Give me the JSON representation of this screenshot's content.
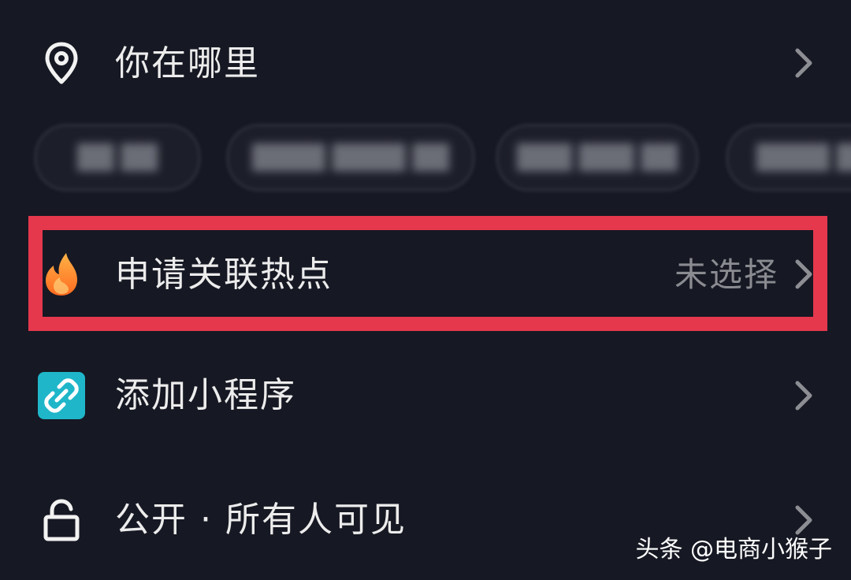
{
  "rows": {
    "location": {
      "label": "你在哪里",
      "icon": "location-pin-icon"
    },
    "hotspot": {
      "label": "申请关联热点",
      "value": "未选择",
      "icon": "flame-icon",
      "icon_color": "#ff8a2a"
    },
    "mini_program": {
      "label": "添加小程序",
      "icon": "mini-program-icon",
      "icon_color": "#1fb6c9"
    },
    "visibility": {
      "label": "公开 · 所有人可见",
      "icon": "unlock-icon"
    }
  },
  "colors": {
    "background": "#161823",
    "highlight": "#e5384d",
    "text": "#ececec",
    "muted": "#8a8b91"
  },
  "watermark": "头条 @电商小猴子"
}
